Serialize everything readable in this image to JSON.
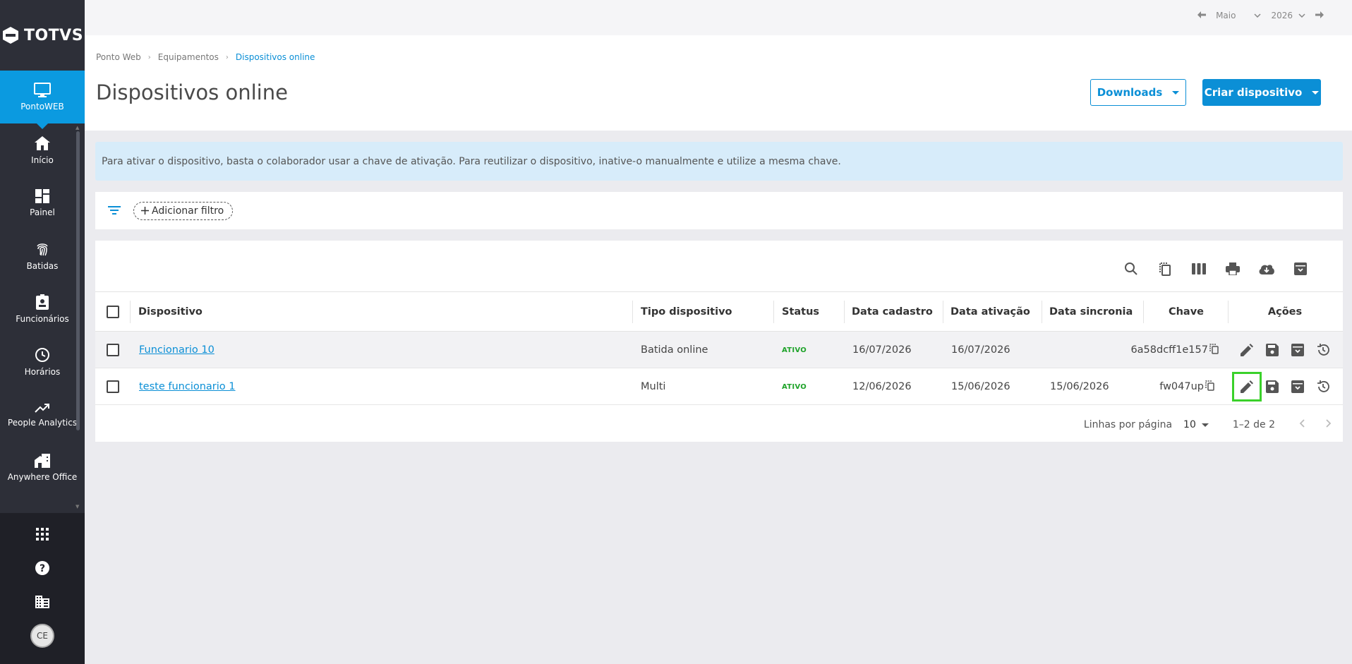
{
  "brand": {
    "name": "TOTVS"
  },
  "sidebar": {
    "active": {
      "label": "PontoWEB",
      "icon": "monitor-icon"
    },
    "items": [
      {
        "label": "Início",
        "icon": "home-icon"
      },
      {
        "label": "Painel",
        "icon": "dashboard-icon"
      },
      {
        "label": "Batidas",
        "icon": "fingerprint-icon"
      },
      {
        "label": "Funcionários",
        "icon": "badge-icon"
      },
      {
        "label": "Horários",
        "icon": "clock-icon"
      },
      {
        "label": "People Analytics",
        "icon": "trending-up-icon"
      },
      {
        "label": "Anywhere Office",
        "icon": "home-work-icon"
      }
    ],
    "bottom": [
      {
        "icon": "apps-grid-icon"
      },
      {
        "icon": "help-icon"
      },
      {
        "icon": "building-icon"
      }
    ],
    "avatar_initials": "CE"
  },
  "topbar": {
    "month": "Maio",
    "year": "2026"
  },
  "breadcrumb": {
    "items": [
      "Ponto Web",
      "Equipamentos",
      "Dispositivos online"
    ]
  },
  "header": {
    "title": "Dispositivos online",
    "downloads_label": "Downloads",
    "create_label": "Criar dispositivo"
  },
  "banner": {
    "text": "Para ativar o dispositivo, basta o colaborador usar a chave de ativação. Para reutilizar o dispositivo, inative-o manualmente e utilize a mesma chave."
  },
  "filter": {
    "add_label": "Adicionar filtro"
  },
  "toolbar": {
    "icons": [
      "search-icon",
      "copy-icon",
      "columns-icon",
      "print-icon",
      "cloud-download-icon",
      "archive-icon"
    ]
  },
  "table": {
    "headers": {
      "dispositivo": "Dispositivo",
      "tipo": "Tipo dispositivo",
      "status": "Status",
      "data_cadastro": "Data cadastro",
      "data_ativacao": "Data ativação",
      "data_sincronia": "Data sincronia",
      "chave": "Chave",
      "acoes": "Ações"
    },
    "rows": [
      {
        "dispositivo": "Funcionario 10",
        "tipo": "Batida online",
        "status": "ATIVO",
        "data_cadastro": "16/07/2026",
        "data_ativacao": "16/07/2026",
        "data_sincronia": "",
        "chave": "6a58dcff1e157"
      },
      {
        "dispositivo": "teste funcionario 1",
        "tipo": "Multi",
        "status": "ATIVO",
        "data_cadastro": "12/06/2026",
        "data_ativacao": "15/06/2026",
        "data_sincronia": "15/06/2026",
        "chave": "fw047up"
      }
    ],
    "pagination": {
      "rows_per_page_label": "Linhas por página",
      "rows_per_page": "10",
      "range": "1–2 de 2"
    }
  },
  "colors": {
    "primary": "#0b8fd6",
    "sidebar_bg": "#2d2f38",
    "active_nav": "#0b9ae0",
    "status_active": "#1fa32a",
    "highlight": "#3ad12a"
  }
}
